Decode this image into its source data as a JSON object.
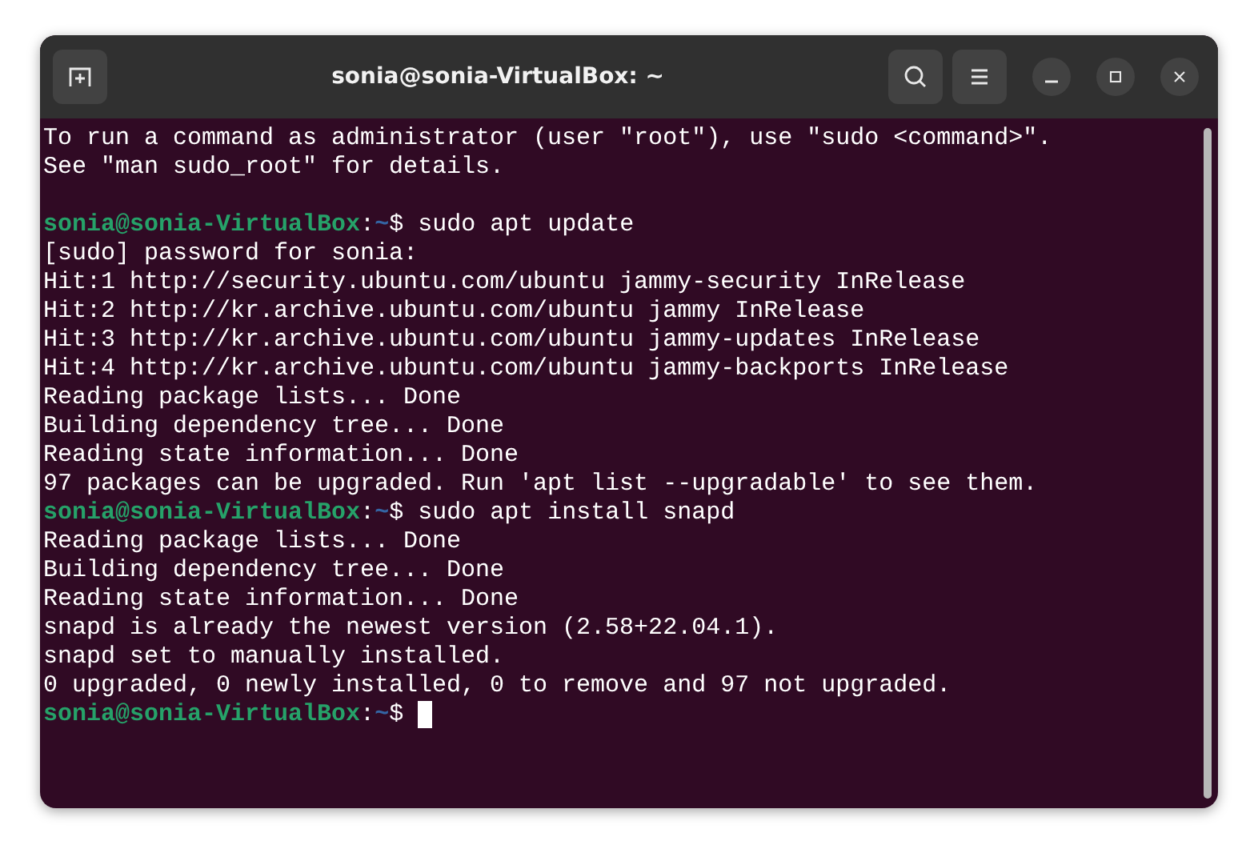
{
  "window": {
    "title": "sonia@sonia-VirtualBox: ~"
  },
  "lines": [
    {
      "kind": "output",
      "text": "To run a command as administrator (user \"root\"), use \"sudo <command>\"."
    },
    {
      "kind": "output",
      "text": "See \"man sudo_root\" for details."
    },
    {
      "kind": "blank"
    },
    {
      "kind": "prompt",
      "user": "sonia@sonia-VirtualBox",
      "separator": ":",
      "path": "~",
      "symbol": "$",
      "command": "sudo apt update",
      "cursor": false
    },
    {
      "kind": "output",
      "text": "[sudo] password for sonia:"
    },
    {
      "kind": "output",
      "text": "Hit:1 http://security.ubuntu.com/ubuntu jammy-security InRelease"
    },
    {
      "kind": "output",
      "text": "Hit:2 http://kr.archive.ubuntu.com/ubuntu jammy InRelease"
    },
    {
      "kind": "output",
      "text": "Hit:3 http://kr.archive.ubuntu.com/ubuntu jammy-updates InRelease"
    },
    {
      "kind": "output",
      "text": "Hit:4 http://kr.archive.ubuntu.com/ubuntu jammy-backports InRelease"
    },
    {
      "kind": "output",
      "text": "Reading package lists... Done"
    },
    {
      "kind": "output",
      "text": "Building dependency tree... Done"
    },
    {
      "kind": "output",
      "text": "Reading state information... Done"
    },
    {
      "kind": "output",
      "text": "97 packages can be upgraded. Run 'apt list --upgradable' to see them."
    },
    {
      "kind": "prompt",
      "user": "sonia@sonia-VirtualBox",
      "separator": ":",
      "path": "~",
      "symbol": "$",
      "command": "sudo apt install snapd",
      "cursor": false
    },
    {
      "kind": "output",
      "text": "Reading package lists... Done"
    },
    {
      "kind": "output",
      "text": "Building dependency tree... Done"
    },
    {
      "kind": "output",
      "text": "Reading state information... Done"
    },
    {
      "kind": "output",
      "text": "snapd is already the newest version (2.58+22.04.1)."
    },
    {
      "kind": "output",
      "text": "snapd set to manually installed."
    },
    {
      "kind": "output",
      "text": "0 upgraded, 0 newly installed, 0 to remove and 97 not upgraded."
    },
    {
      "kind": "prompt",
      "user": "sonia@sonia-VirtualBox",
      "separator": ":",
      "path": "~",
      "symbol": "$",
      "cursor": true
    }
  ]
}
